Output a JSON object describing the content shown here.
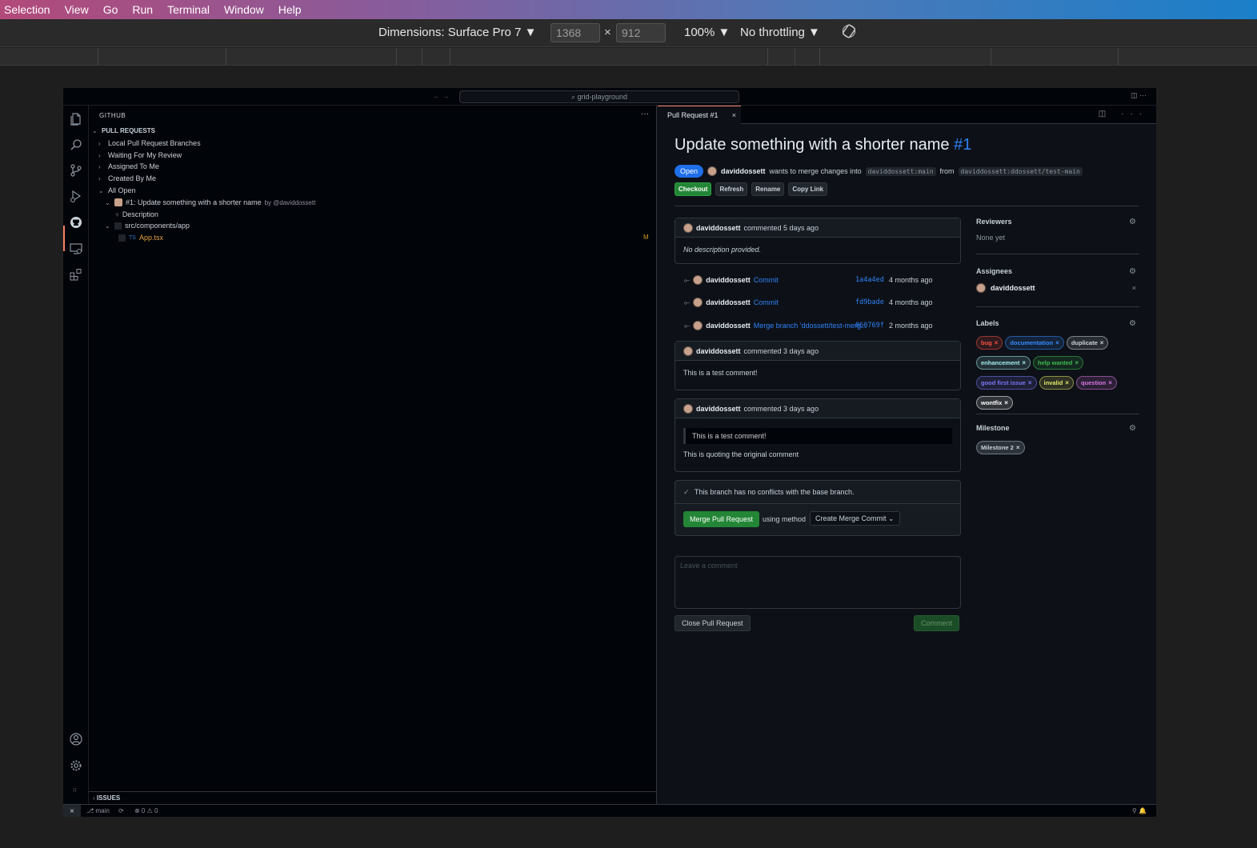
{
  "menu": [
    "Selection",
    "View",
    "Go",
    "Run",
    "Terminal",
    "Window",
    "Help"
  ],
  "device_toolbar": {
    "dimensions_label": "Dimensions: Surface Pro 7 ▼",
    "width": "1368",
    "height": "912",
    "times": "×",
    "zoom": "100% ▼",
    "throttling": "No throttling ▼",
    "rotate_icon": "rotate-icon"
  },
  "window": {
    "command_center": "⌕ grid-playground",
    "nav_arrows": "← →"
  },
  "activity_icons": [
    "explorer-icon",
    "search-icon",
    "source-control-icon",
    "run-debug-icon",
    "github-icon",
    "remote-explorer-icon",
    "extensions-icon",
    "account-icon",
    "settings-icon"
  ],
  "sidebar": {
    "title": "GITHUB",
    "more": "···",
    "section": "PULL REQUESTS",
    "items": [
      {
        "label": "Local Pull Request Branches",
        "chevron": "›"
      },
      {
        "label": "Waiting For My Review",
        "chevron": "›"
      },
      {
        "label": "Assigned To Me",
        "chevron": "›"
      },
      {
        "label": "Created By Me",
        "chevron": "›"
      },
      {
        "label": "All Open",
        "chevron": "⌄"
      }
    ],
    "pr_item": {
      "label": "#1: Update something with a shorter name",
      "author": "by @daviddossett",
      "chevron": "⌄"
    },
    "description": "Description",
    "folder": "src/components/app",
    "file": {
      "lang": "TS",
      "name": "App.tsx",
      "status": "M"
    },
    "issues": "ISSUES"
  },
  "editor": {
    "tab_label": "Pull Request #1",
    "tab_close": "×",
    "tab_actions": "◫ ···",
    "title": "Update something with a shorter name",
    "number": "#1",
    "state": "Open",
    "author": "daviddossett",
    "merge_text": "wants to merge changes into",
    "base_branch": "daviddossett:main",
    "from_text": "from",
    "head_branch": "daviddossett:ddossett/test-main",
    "actions": [
      "Checkout",
      "Refresh",
      "Rename",
      "Copy Link"
    ],
    "description_card": {
      "author": "daviddossett",
      "when": "commented 5 days ago",
      "body": "No description provided."
    },
    "commits": [
      {
        "author": "daviddossett",
        "message": "Commit",
        "sha": "1a4a4ed",
        "when": "4 months ago"
      },
      {
        "author": "daviddossett",
        "message": "Commit",
        "sha": "fd9bade",
        "when": "4 months ago"
      },
      {
        "author": "daviddossett",
        "message": "Merge branch 'ddossett/test-merg...",
        "sha": "060769f",
        "when": "2 months ago"
      }
    ],
    "comment1": {
      "author": "daviddossett",
      "when": "commented 3 days ago",
      "body": "This is a test comment!"
    },
    "comment2": {
      "author": "daviddossett",
      "when": "commented 3 days ago",
      "quote": "This is a test comment!",
      "body": "This is quoting the original comment"
    },
    "merge_box": {
      "status": "This branch has no conflicts with the base branch.",
      "check": "✓",
      "button": "Merge Pull Request",
      "using": "using method",
      "method": "Create Merge Commit ⌄"
    },
    "comment_placeholder": "Leave a comment",
    "close_button": "Close Pull Request",
    "comment_button": "Comment"
  },
  "sidepanel": {
    "reviewers_title": "Reviewers",
    "reviewers_value": "None yet",
    "assignees_title": "Assignees",
    "assignee": "daviddossett",
    "remove": "×",
    "gear": "⚙",
    "labels_title": "Labels",
    "labels": [
      {
        "name": "bug",
        "color": "#f85149"
      },
      {
        "name": "documentation",
        "color": "#388bfd"
      },
      {
        "name": "duplicate",
        "color": "#c9d1d9"
      },
      {
        "name": "enhancement",
        "color": "#a2eeef"
      },
      {
        "name": "help wanted",
        "color": "#3fb950"
      },
      {
        "name": "good first issue",
        "color": "#7d77f5"
      },
      {
        "name": "invalid",
        "color": "#e4e669"
      },
      {
        "name": "question",
        "color": "#d876e3"
      },
      {
        "name": "wontfix",
        "color": "#ffffff"
      }
    ],
    "milestone_title": "Milestone",
    "milestone": "Milestone 2"
  },
  "statusbar": {
    "remote": "⨯",
    "branch": "⎇ main",
    "sync": "⟳",
    "problems": "⊗ 0 ⚠ 0",
    "right": "⚲  🔔"
  }
}
